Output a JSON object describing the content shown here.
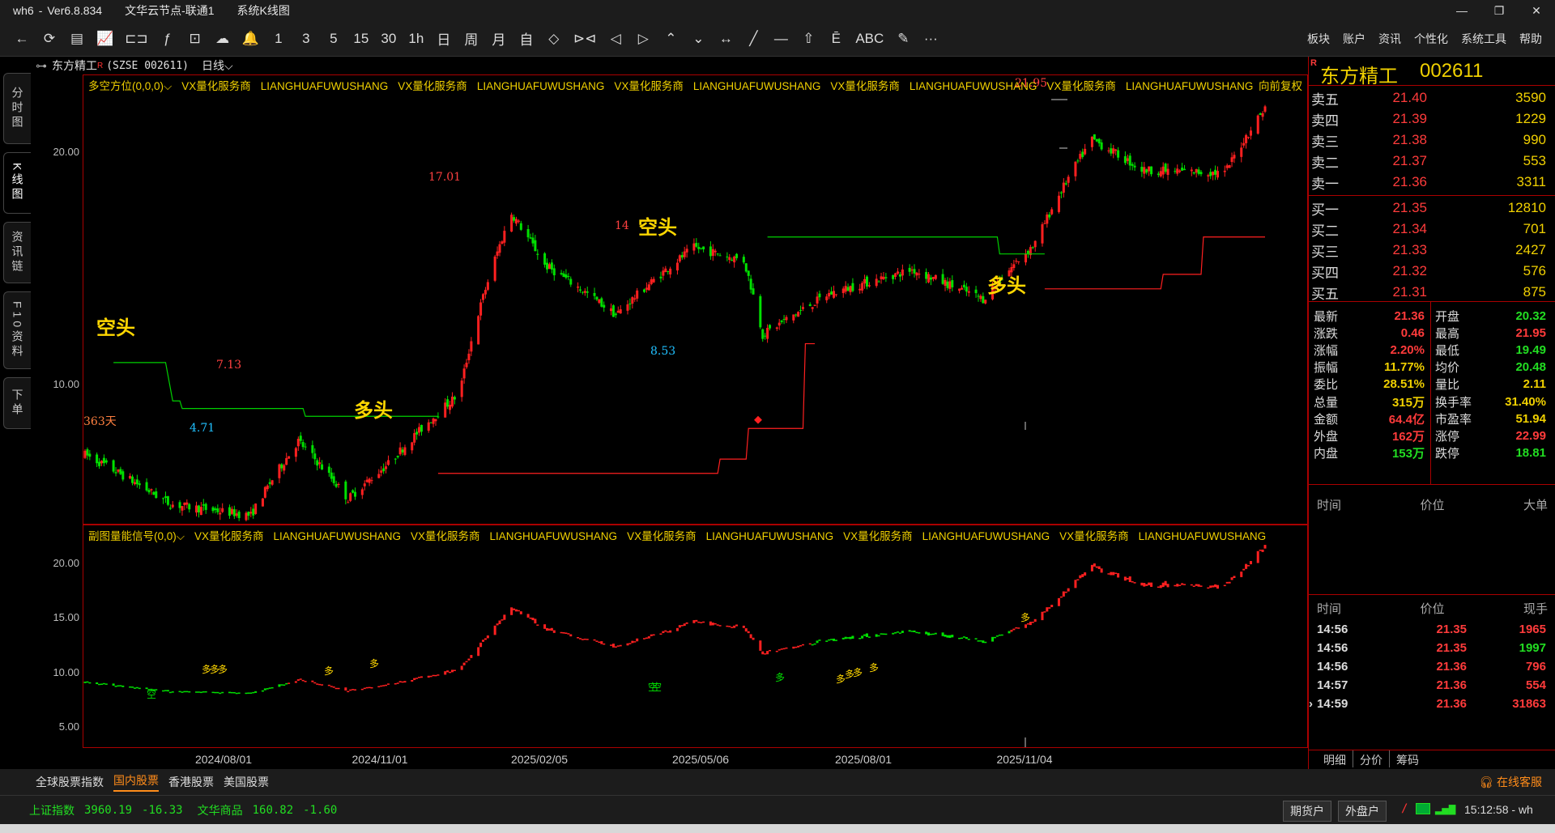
{
  "window": {
    "app": "wh6",
    "version": "Ver6.8.834",
    "server": "文华云节点-联通1",
    "view": "系统K线图",
    "controls": [
      "—",
      "❐",
      "✕"
    ]
  },
  "toolbar": {
    "tools": [
      "←",
      "⟳",
      "▤",
      "📈",
      "⊏⊐",
      "ƒ",
      "⊡",
      "☁",
      "🔔",
      "1",
      "3",
      "5",
      "15",
      "30",
      "1h",
      "日",
      "周",
      "月",
      "自",
      "◇",
      "⊳⊲",
      "◁",
      "▷",
      "⌃",
      "⌄",
      "↔",
      "╱",
      "—",
      "⇧",
      "Ē",
      "ABC",
      "✎",
      "···"
    ],
    "menu": [
      "板块",
      "账户",
      "资讯",
      "个性化",
      "系统工具",
      "帮助"
    ]
  },
  "left_tabs": [
    "分时图",
    "K线图",
    "资讯链",
    "F10资料",
    "下单"
  ],
  "chart_header": {
    "symbol": "东方精工",
    "code": "(SZSE 002611)",
    "period": "日线"
  },
  "main_chart": {
    "indicator": "多空方位(0,0,0)",
    "sponsor": [
      "VX量化服务商",
      "LIANGHUAFUWUSHANG",
      "VX量化服务商",
      "LIANGHUAFUWUSHANG",
      "VX量化服务商",
      "LIANGHUAFUWUSHANG",
      "VX量化服务商",
      "LIANGHUAFUWUSHANG",
      "VX量化服务商",
      "LIANGHUAFUWUSHANG"
    ],
    "adjust": "向前复权",
    "y_ticks": [
      "20.00",
      "10.00"
    ],
    "annotations": [
      "空头",
      "多头",
      "空头",
      "多头"
    ],
    "price_marks": [
      "17.01",
      "7.13",
      "4.71",
      "14",
      "8.53",
      "21.95"
    ],
    "days": "363天"
  },
  "sub_chart": {
    "indicator": "副图量能信号(0,0)",
    "sponsor": [
      "VX量化服务商",
      "LIANGHUAFUWUSHANG",
      "VX量化服务商",
      "LIANGHUAFUWUSHANG",
      "VX量化服务商",
      "LIANGHUAFUWUSHANG",
      "VX量化服务商",
      "LIANGHUAFUWUSHANG",
      "VX量化服务商",
      "LIANGHUAFUWUSHANG"
    ],
    "y_ticks": [
      "20.00",
      "15.00",
      "10.00",
      "5.00"
    ],
    "signals": [
      "空",
      "多",
      "多",
      "多",
      "多",
      "多",
      "空",
      "空",
      "多",
      "多",
      "多",
      "多",
      "多",
      "多"
    ]
  },
  "x_axis": [
    "2024/08/01",
    "2024/11/01",
    "2025/02/05",
    "2025/05/06",
    "2025/08/01",
    "2025/11/04"
  ],
  "quote": {
    "badge": "R",
    "name": "东方精工",
    "code": "002611",
    "asks": [
      {
        "label": "卖五",
        "price": "21.40",
        "vol": "3590"
      },
      {
        "label": "卖四",
        "price": "21.39",
        "vol": "1229"
      },
      {
        "label": "卖三",
        "price": "21.38",
        "vol": "990"
      },
      {
        "label": "卖二",
        "price": "21.37",
        "vol": "553"
      },
      {
        "label": "卖一",
        "price": "21.36",
        "vol": "3311"
      }
    ],
    "bids": [
      {
        "label": "买一",
        "price": "21.35",
        "vol": "12810"
      },
      {
        "label": "买二",
        "price": "21.34",
        "vol": "701"
      },
      {
        "label": "买三",
        "price": "21.33",
        "vol": "2427"
      },
      {
        "label": "买四",
        "price": "21.32",
        "vol": "576"
      },
      {
        "label": "买五",
        "price": "21.31",
        "vol": "875"
      }
    ],
    "stats": [
      {
        "l1": "最新",
        "v1": "21.36",
        "c1": "#ff3b3b",
        "l2": "开盘",
        "v2": "20.32",
        "c2": "#22dd22"
      },
      {
        "l1": "涨跌",
        "v1": "0.46",
        "c1": "#ff3b3b",
        "l2": "最高",
        "v2": "21.95",
        "c2": "#ff3b3b"
      },
      {
        "l1": "涨幅",
        "v1": "2.20%",
        "c1": "#ff3b3b",
        "l2": "最低",
        "v2": "19.49",
        "c2": "#22dd22"
      },
      {
        "l1": "振幅",
        "v1": "11.77%",
        "c1": "#f0d000",
        "l2": "均价",
        "v2": "20.48",
        "c2": "#22dd22"
      },
      {
        "l1": "委比",
        "v1": "28.51%",
        "c1": "#f0d000",
        "l2": "量比",
        "v2": "2.11",
        "c2": "#f0d000"
      },
      {
        "l1": "总量",
        "v1": "315万",
        "c1": "#f0d000",
        "l2": "换手率",
        "v2": "31.40%",
        "c2": "#f0d000"
      },
      {
        "l1": "金额",
        "v1": "64.4亿",
        "c1": "#ff3b3b",
        "l2": "市盈率",
        "v2": "51.94",
        "c2": "#f0d000"
      },
      {
        "l1": "外盘",
        "v1": "162万",
        "c1": "#ff3b3b",
        "l2": "涨停",
        "v2": "22.99",
        "c2": "#ff3b3b"
      },
      {
        "l1": "内盘",
        "v1": "153万",
        "c1": "#22dd22",
        "l2": "跌停",
        "v2": "18.81",
        "c2": "#22dd22"
      }
    ],
    "big_headers": [
      "时间",
      "价位",
      "大单"
    ],
    "tick_headers": [
      "时间",
      "价位",
      "现手"
    ],
    "ticks": [
      {
        "time": "14:56",
        "price": "21.35",
        "vol": "1965",
        "vcolor": "#ff3b3b"
      },
      {
        "time": "14:56",
        "price": "21.35",
        "vol": "1997",
        "vcolor": "#22dd22"
      },
      {
        "time": "14:56",
        "price": "21.36",
        "vol": "796",
        "vcolor": "#ff3b3b"
      },
      {
        "time": "14:57",
        "price": "21.36",
        "vol": "554",
        "vcolor": "#ff3b3b"
      },
      {
        "time": "14:59",
        "price": "21.36",
        "vol": "31863",
        "vcolor": "#ff3b3b"
      }
    ],
    "tick_marker": "›",
    "tabs": [
      "明细",
      "分价",
      "筹码"
    ]
  },
  "bottom_tabs": [
    "全球股票指数",
    "国内股票",
    "香港股票",
    "美国股票"
  ],
  "service": "在线客服",
  "status": {
    "idx1_name": "上证指数",
    "idx1_val": "3960.19",
    "idx1_chg": "-16.33",
    "idx2_name": "文华商品",
    "idx2_val": "160.82",
    "idx2_chg": "-1.60",
    "btn1": "期货户",
    "btn2": "外盘户",
    "time": "15:12:58 - wh"
  },
  "chart_data": {
    "type": "candlestick",
    "title": "东方精工 (SZSE 002611) 日线",
    "x_ticks": [
      "2024/08/01",
      "2024/11/01",
      "2025/02/05",
      "2025/05/06",
      "2025/08/01",
      "2025/11/04"
    ],
    "y_ticks": [
      10.0,
      20.0
    ],
    "y_scale": "log",
    "x_range": [
      "2024/06/26",
      "2025/11/06"
    ],
    "notes": [
      "high 17.01",
      "high 7.13",
      "low 4.71",
      "high 14",
      "low 8.53",
      "high 21.95"
    ],
    "key_closes": [
      {
        "date": "2024/06/26",
        "close": 6.0
      },
      {
        "date": "2024/08/01",
        "close": 5.0
      },
      {
        "date": "2024/09/04",
        "close": 4.8
      },
      {
        "date": "2024/09/24",
        "close": 6.3
      },
      {
        "date": "2024/10/15",
        "close": 5.1
      },
      {
        "date": "2024/11/01",
        "close": 5.8
      },
      {
        "date": "2024/12/01",
        "close": 7.5
      },
      {
        "date": "2024/12/23",
        "close": 14.5
      },
      {
        "date": "2025/01/06",
        "close": 12.0
      },
      {
        "date": "2025/02/05",
        "close": 10.0
      },
      {
        "date": "2025/03/10",
        "close": 12.8
      },
      {
        "date": "2025/03/31",
        "close": 12.2
      },
      {
        "date": "2025/04/08",
        "close": 9.3
      },
      {
        "date": "2025/05/06",
        "close": 10.8
      },
      {
        "date": "2025/06/10",
        "close": 11.8
      },
      {
        "date": "2025/07/10",
        "close": 10.6
      },
      {
        "date": "2025/08/01",
        "close": 13.0
      },
      {
        "date": "2025/08/25",
        "close": 19.0
      },
      {
        "date": "2025/09/15",
        "close": 17.0
      },
      {
        "date": "2025/10/20",
        "close": 16.8
      },
      {
        "date": "2025/11/06",
        "close": 21.36
      }
    ]
  }
}
